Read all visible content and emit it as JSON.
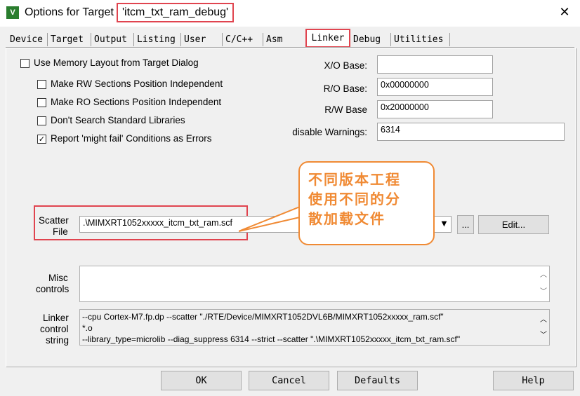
{
  "window": {
    "title_prefix": "Options for Target",
    "title_target": "'itcm_txt_ram_debug'",
    "app_icon": "keil-uvision-icon",
    "close_glyph": "✕"
  },
  "tabs": [
    "Device",
    "Target",
    "Output",
    "Listing",
    "User",
    "C/C++",
    "Asm",
    "Linker",
    "Debug",
    "Utilities"
  ],
  "active_tab": "Linker",
  "options": {
    "use_memory_layout": {
      "label": "Use Memory Layout from Target Dialog",
      "checked": false
    },
    "rw_independent": {
      "label": "Make RW Sections Position Independent",
      "checked": false
    },
    "ro_independent": {
      "label": "Make RO Sections Position Independent",
      "checked": false
    },
    "no_std_libs": {
      "label": "Don't Search Standard Libraries",
      "checked": false
    },
    "might_fail": {
      "label": "Report 'might fail' Conditions as Errors",
      "checked": true
    }
  },
  "addresses": {
    "xo_label": "X/O Base:",
    "xo_value": "",
    "ro_label": "R/O Base:",
    "ro_value": "0x00000000",
    "rw_label": "R/W Base",
    "rw_value": "0x20000000",
    "warn_label": "disable Warnings:",
    "warn_value": "6314"
  },
  "scatter": {
    "label_line1": "Scatter",
    "label_line2": "File",
    "value": ".\\MIMXRT1052xxxxx_itcm_txt_ram.scf",
    "browse_label": "...",
    "edit_label": "Edit..."
  },
  "callout": {
    "line1": "不同版本工程",
    "line2": "使用不同的分",
    "line3": "散加载文件"
  },
  "misc": {
    "label_line1": "Misc",
    "label_line2": "controls",
    "value": ""
  },
  "linker_string": {
    "label_line1": "Linker",
    "label_line2": "control",
    "label_line3": "string",
    "line1": "--cpu Cortex-M7.fp.dp --scatter \"./RTE/Device/MIMXRT1052DVL6B/MIMXRT1052xxxxx_ram.scf\"",
    "line2": "*.o",
    "line3": "--library_type=microlib --diag_suppress 6314 --strict --scatter \".\\MIMXRT1052xxxxx_itcm_txt_ram.scf\""
  },
  "buttons": {
    "ok": "OK",
    "cancel": "Cancel",
    "defaults": "Defaults",
    "help": "Help"
  },
  "colors": {
    "highlight_red": "#e0444f",
    "callout_orange": "#f08a34",
    "dialog_bg": "#f0f0f0"
  }
}
